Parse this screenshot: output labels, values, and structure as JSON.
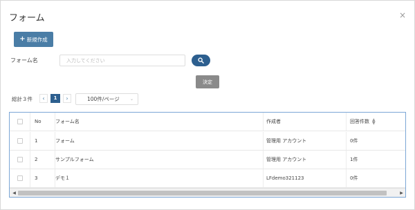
{
  "dialog": {
    "title": "フォーム",
    "close_symbol": "×"
  },
  "toolbar": {
    "new_label": "新規作成",
    "new_icon": "plus-icon"
  },
  "search": {
    "label": "フォーム名",
    "placeholder": "入力してください",
    "value": "",
    "button_icon": "search-icon"
  },
  "actions": {
    "ok_label": "決定"
  },
  "pagination": {
    "total_label": "総計３件",
    "current_page": "1",
    "per_page": "100件/ページ"
  },
  "table": {
    "columns": [
      "No",
      "フォーム名",
      "作成者",
      "回答件数"
    ],
    "rows": [
      {
        "no": "1",
        "name": "フォーム",
        "author": "管理用 アカウント",
        "count": "0件"
      },
      {
        "no": "2",
        "name": "サンプルフォーム",
        "author": "管理用 アカウント",
        "count": "1件"
      },
      {
        "no": "3",
        "name": "デモ１",
        "author": "LFdemo321123",
        "count": "0件"
      }
    ]
  },
  "colors": {
    "primary": "#4a7da6",
    "dark_primary": "#2d5f8f",
    "grid_border": "#7aa6d6",
    "ok_button": "#8a8a8a"
  }
}
